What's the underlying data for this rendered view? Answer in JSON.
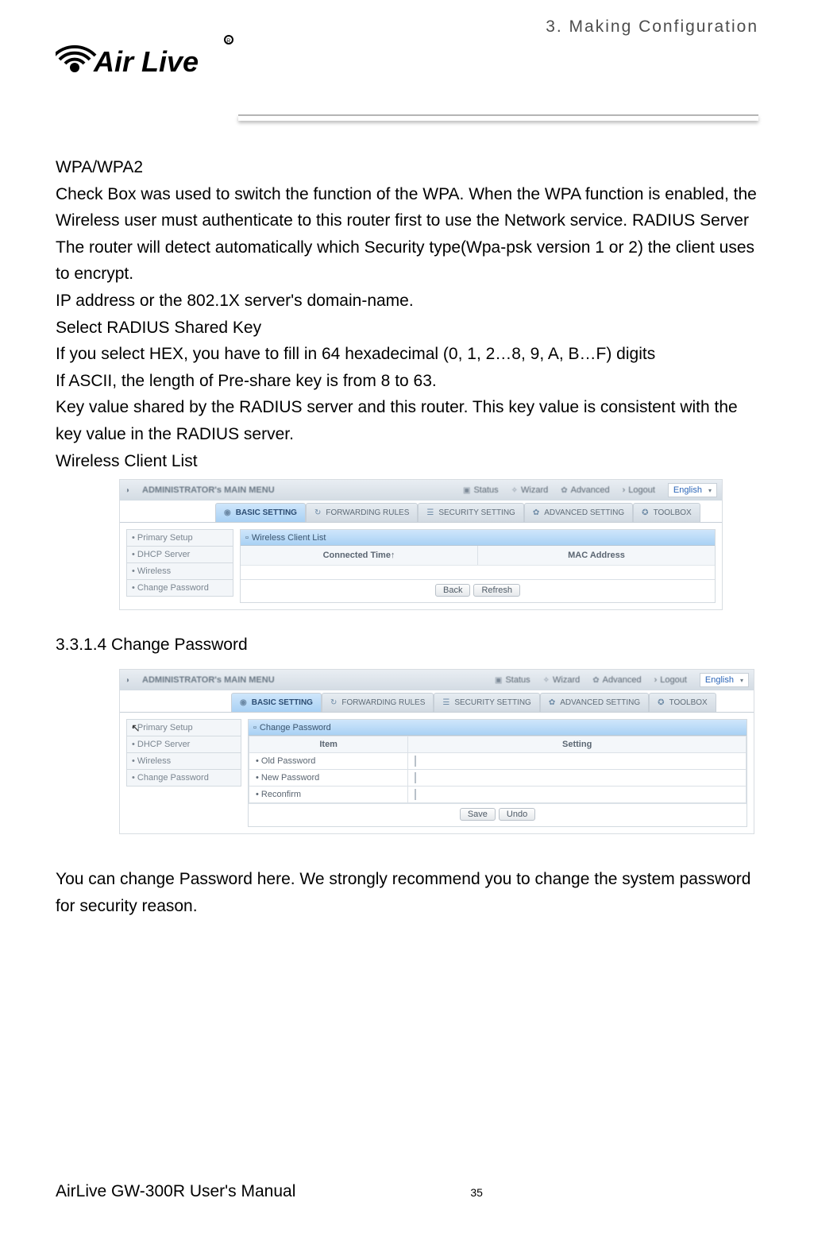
{
  "header": {
    "logo_text": "AirLive",
    "chapter": "3. Making Configuration"
  },
  "wpa": {
    "title": "WPA/WPA2",
    "p1": "Check Box was used to switch the function of the WPA. When the WPA function is enabled, the Wireless user must authenticate to this router first to use the Network service. RADIUS Server",
    "p2": "The router will detect automatically   which Security type(Wpa-psk version 1 or 2) the client uses to encrypt.",
    "p3": "IP address or the 802.1X server's domain-name.",
    "p4": "Select RADIUS Shared Key",
    "p5": "If you select HEX, you have to fill in 64 hexadecimal (0, 1, 2…8, 9, A, B…F) digits",
    "p6": "If ASCII, the length of Pre-share key is from 8 to 63.",
    "p7": "Key value shared by the RADIUS server and this router. This key value is consistent with the key value in the RADIUS server.",
    "p8": "Wireless Client List"
  },
  "ui1": {
    "main_menu_title": "ADMINISTRATOR's MAIN MENU",
    "status": "Status",
    "wizard": "Wizard",
    "advanced": "Advanced",
    "logout": "Logout",
    "lang": "English",
    "tabs": {
      "basic": "BASIC SETTING",
      "forwarding": "FORWARDING RULES",
      "security": "SECURITY SETTING",
      "advsetting": "ADVANCED SETTING",
      "toolbox": "TOOLBOX"
    },
    "sidebar": [
      "Primary Setup",
      "DHCP Server",
      "Wireless",
      "Change Password"
    ],
    "panel_title": "Wireless Client List",
    "col1": "Connected Time↑",
    "col2": "MAC Address",
    "btn_back": "Back",
    "btn_refresh": "Refresh"
  },
  "section_heading": "3.3.1.4 Change Password",
  "ui2": {
    "main_menu_title": "ADMINISTRATOR's MAIN MENU",
    "status": "Status",
    "wizard": "Wizard",
    "advanced": "Advanced",
    "logout": "Logout",
    "lang": "English",
    "tabs": {
      "basic": "BASIC SETTING",
      "forwarding": "FORWARDING RULES",
      "security": "SECURITY SETTING",
      "advsetting": "ADVANCED SETTING",
      "toolbox": "TOOLBOX"
    },
    "sidebar": [
      "Primary Setup",
      "DHCP Server",
      "Wireless",
      "Change Password"
    ],
    "panel_title": "Change Password",
    "th_item": "Item",
    "th_setting": "Setting",
    "rows": [
      "Old Password",
      "New Password",
      "Reconfirm"
    ],
    "btn_save": "Save",
    "btn_undo": "Undo"
  },
  "closing": "You can change Password here. We strongly recommend you to change the system password for security reason.",
  "footer": {
    "manual": "AirLive GW-300R User's Manual",
    "page": "35"
  }
}
